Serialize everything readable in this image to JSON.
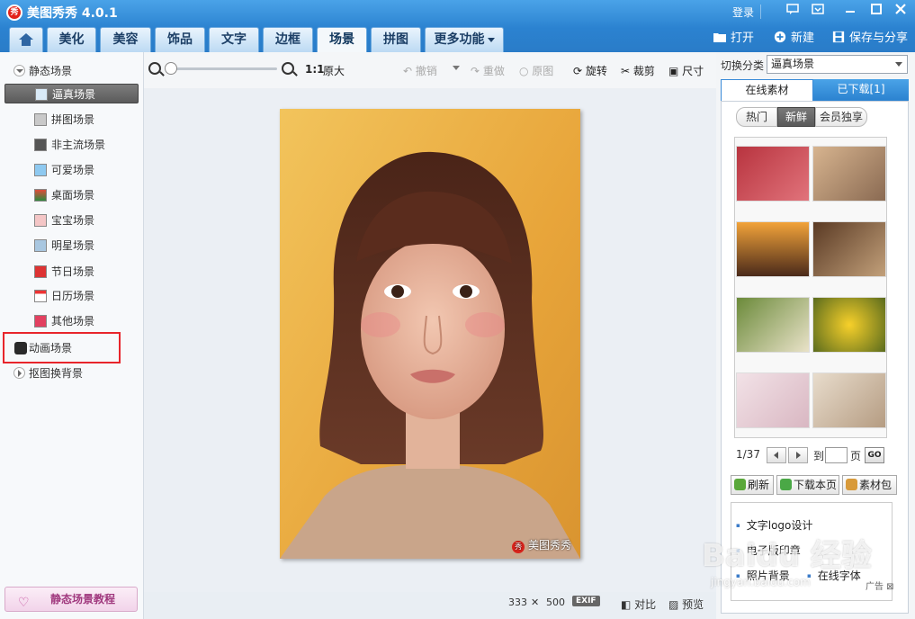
{
  "app": {
    "title": "美图秀秀 4.0.1",
    "logo_text": "秀"
  },
  "window": {
    "login": "登录"
  },
  "tabs": [
    {
      "label": "美化"
    },
    {
      "label": "美容"
    },
    {
      "label": "饰品"
    },
    {
      "label": "文字"
    },
    {
      "label": "边框"
    },
    {
      "label": "场景"
    },
    {
      "label": "拼图"
    },
    {
      "label": "更多功能"
    }
  ],
  "actions": {
    "open": "打开",
    "new": "新建",
    "save_share": "保存与分享"
  },
  "sidebar": {
    "static_category": "静态场景",
    "items": [
      {
        "label": "逼真场景"
      },
      {
        "label": "拼图场景"
      },
      {
        "label": "非主流场景"
      },
      {
        "label": "可爱场景"
      },
      {
        "label": "桌面场景"
      },
      {
        "label": "宝宝场景"
      },
      {
        "label": "明星场景"
      },
      {
        "label": "节日场景"
      },
      {
        "label": "日历场景"
      },
      {
        "label": "其他场景"
      }
    ],
    "animation_category": "动画场景",
    "matting_category": "抠图换背景",
    "tutorial": "静态场景教程"
  },
  "toolbar": {
    "ratio": "1:1",
    "original_size": "原大",
    "undo": "撤销",
    "redo": "重做",
    "original": "原图",
    "rotate": "旋转",
    "crop": "裁剪",
    "size": "尺寸"
  },
  "photo": {
    "watermark": "美图秀秀"
  },
  "status": {
    "width": "333",
    "times": "✕",
    "height": "500",
    "exif": "EXIF",
    "compare": "对比",
    "preview": "预览"
  },
  "right": {
    "switch_label": "切换分类",
    "switch_value": "逼真场景",
    "tab_online": "在线素材",
    "tab_downloaded": "已下载[1]",
    "filters": [
      {
        "label": "热门"
      },
      {
        "label": "新鲜"
      },
      {
        "label": "会员独享"
      }
    ],
    "page_indicator": "1/37",
    "goto": "到",
    "page_unit": "页",
    "go": "GO",
    "refresh": "刷新",
    "download_page": "下载本页",
    "material_pack": "素材包",
    "ads": [
      "文字logo设计",
      "电子版印章",
      "照片背景",
      "在线字体"
    ],
    "ad_tag": "广告"
  },
  "overlay": {
    "watermark": "Baidu 经验",
    "watermark_url": "jingyan.baidu.com"
  }
}
